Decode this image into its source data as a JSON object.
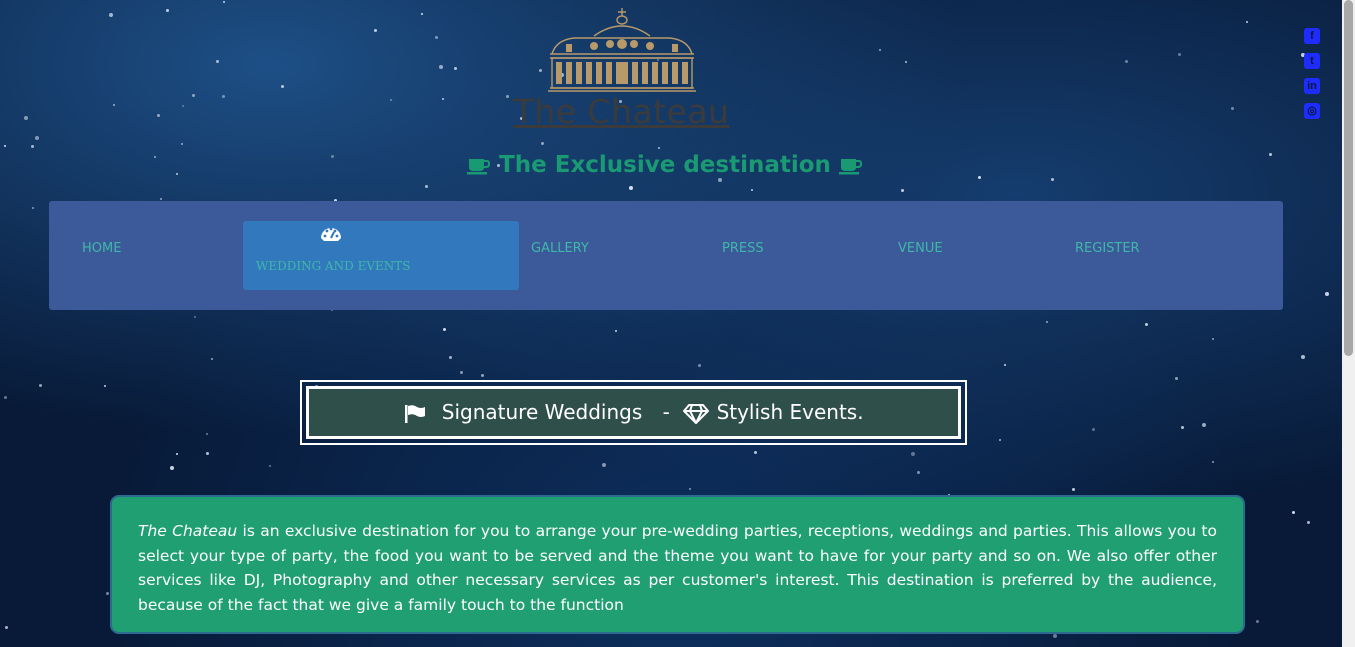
{
  "header": {
    "logo_icon": "chateau-building-logo",
    "brand_title": "The Chateau",
    "tagline": "The Exclusive destination",
    "tagline_icon": "coffee-cup-icon"
  },
  "social": {
    "items": [
      {
        "icon": "facebook-icon"
      },
      {
        "icon": "twitter-icon"
      },
      {
        "icon": "linkedin-icon"
      },
      {
        "icon": "instagram-icon"
      }
    ],
    "color": "#1e2cff"
  },
  "nav": {
    "items": [
      {
        "label": "HOME"
      },
      {
        "label": "WEDDING AND EVENTS",
        "active": true,
        "icon": "dashboard-gauge-icon"
      },
      {
        "label": "GALLERY"
      },
      {
        "label": "PRESS"
      },
      {
        "label": "VENUE"
      },
      {
        "label": "REGISTER"
      }
    ],
    "background": "#3c5a99",
    "active_background": "#3278bd",
    "text_color": "#3fb8a8"
  },
  "banner": {
    "part1": "Signature Weddings",
    "separator": "-",
    "part2": "Stylish Events.",
    "icon1": "flag-icon",
    "icon2": "diamond-icon",
    "background": "#2f4f4a"
  },
  "intro": {
    "brand": "The Chateau",
    "text": " is an exclusive destination for you to arrange your pre-wedding parties, receptions, weddings and parties. This allows you to select your type of party, the food you want to be served and the theme you want to have for your party and so on. We also offer other services like DJ, Photography and other necessary services as per customer's interest. This destination is preferred by the audience, because of the fact that we give a family touch to the function",
    "background": "#1f9f72"
  },
  "colors": {
    "page_background": "#081a38",
    "tagline": "#1a9a72",
    "title": "#3b3b3b"
  }
}
